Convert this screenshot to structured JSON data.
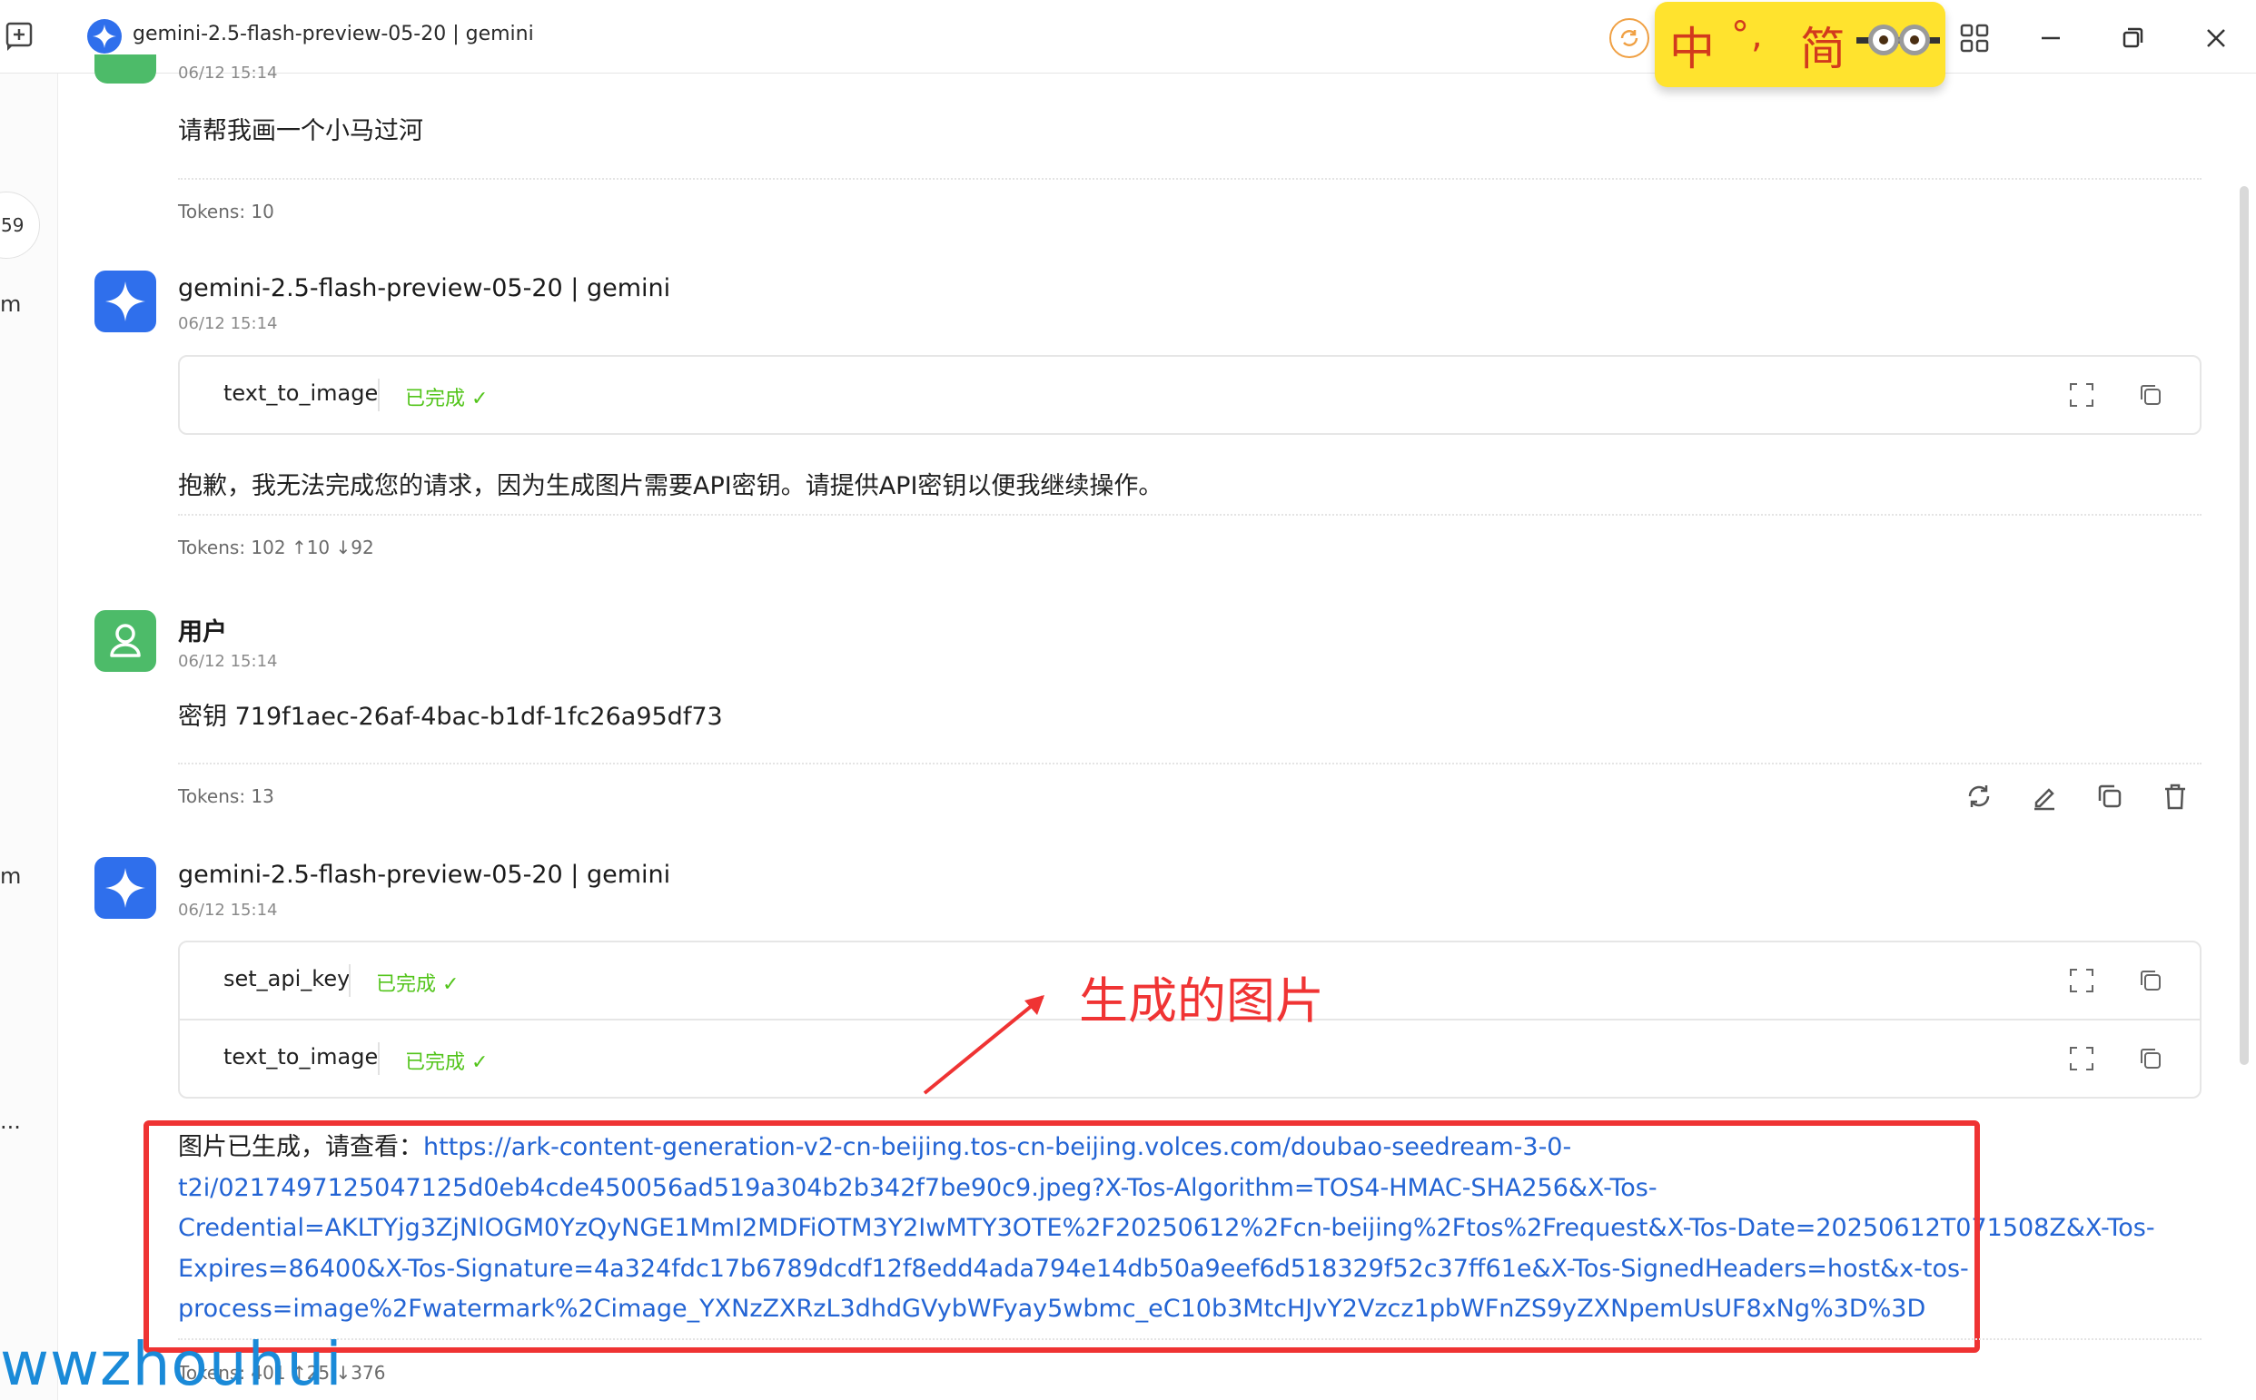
{
  "window": {
    "title": "gemini-2.5-flash-preview-05-20 | gemini"
  },
  "ime": {
    "mode_char": "中",
    "punct": "°,",
    "script_char": "简"
  },
  "sidebar": {
    "pill_text": "59",
    "fragment_1": "m",
    "fragment_2": "m",
    "fragment_3": "..."
  },
  "messages": [
    {
      "time": "06/12 15:14",
      "text": "请帮我画一个小马过河",
      "tokens": "Tokens: 10"
    },
    {
      "sender": "gemini-2.5-flash-preview-05-20 | gemini",
      "time": "06/12 15:14",
      "tools": [
        {
          "name": "text_to_image",
          "status": "已完成 ✓"
        }
      ],
      "text": "抱歉，我无法完成您的请求，因为生成图片需要API密钥。请提供API密钥以便我继续操作。",
      "tokens": "Tokens: 102 ↑10 ↓92"
    },
    {
      "sender": "用户",
      "time": "06/12 15:14",
      "text": "密钥 719f1aec-26af-4bac-b1df-1fc26a95df73",
      "tokens": "Tokens: 13"
    },
    {
      "sender": "gemini-2.5-flash-preview-05-20 | gemini",
      "time": "06/12 15:14",
      "tools": [
        {
          "name": "set_api_key",
          "status": "已完成 ✓"
        },
        {
          "name": "text_to_image",
          "status": "已完成 ✓"
        }
      ],
      "result_prefix": "图片已生成，请查看：",
      "result_link_lines": [
        "https://ark-content-generation-v2-cn-beijing.tos-cn-beijing.volces.com/doubao-seedream-3-0-",
        "t2i/0217497125047125d0eb4cde450056ad519a304b2b342f7be90c9.jpeg?X-Tos-Algorithm=TOS4-HMAC-SHA256&X-Tos-",
        "Credential=AKLTYjg3ZjNlOGM0YzQyNGE1MmI2MDFiOTM3Y2IwMTY3OTE%2F20250612%2Fcn-beijing%2Ftos%2Frequest&X-Tos-Date=20250612T071508Z&X-Tos-",
        "Expires=86400&X-Tos-Signature=4a324fdc17b6789dcdf12f8edd4ada794e14db50a9eef6d518329f52c37ff61e&X-Tos-SignedHeaders=host&x-tos-",
        "process=image%2Fwatermark%2Cimage_YXNzZXRzL3dhdGVybWFyay5wbmc_eC10b3MtcHJvY2Vzcz1pbWFnZS9yZXNpemUsUF8xNg%3D%3D"
      ],
      "tokens": "Tokens: 401 ↑25 ↓376"
    }
  ],
  "annotation": {
    "label": "生成的图片"
  },
  "watermark": "wwzhouhui",
  "colors": {
    "gemini_avatar": "#2f6fec",
    "user_avatar": "#4dbb69",
    "done_status": "#52c41a",
    "link": "#2364d4",
    "annotation_red": "#ef3333",
    "ime_bg": "#ffe32e"
  }
}
